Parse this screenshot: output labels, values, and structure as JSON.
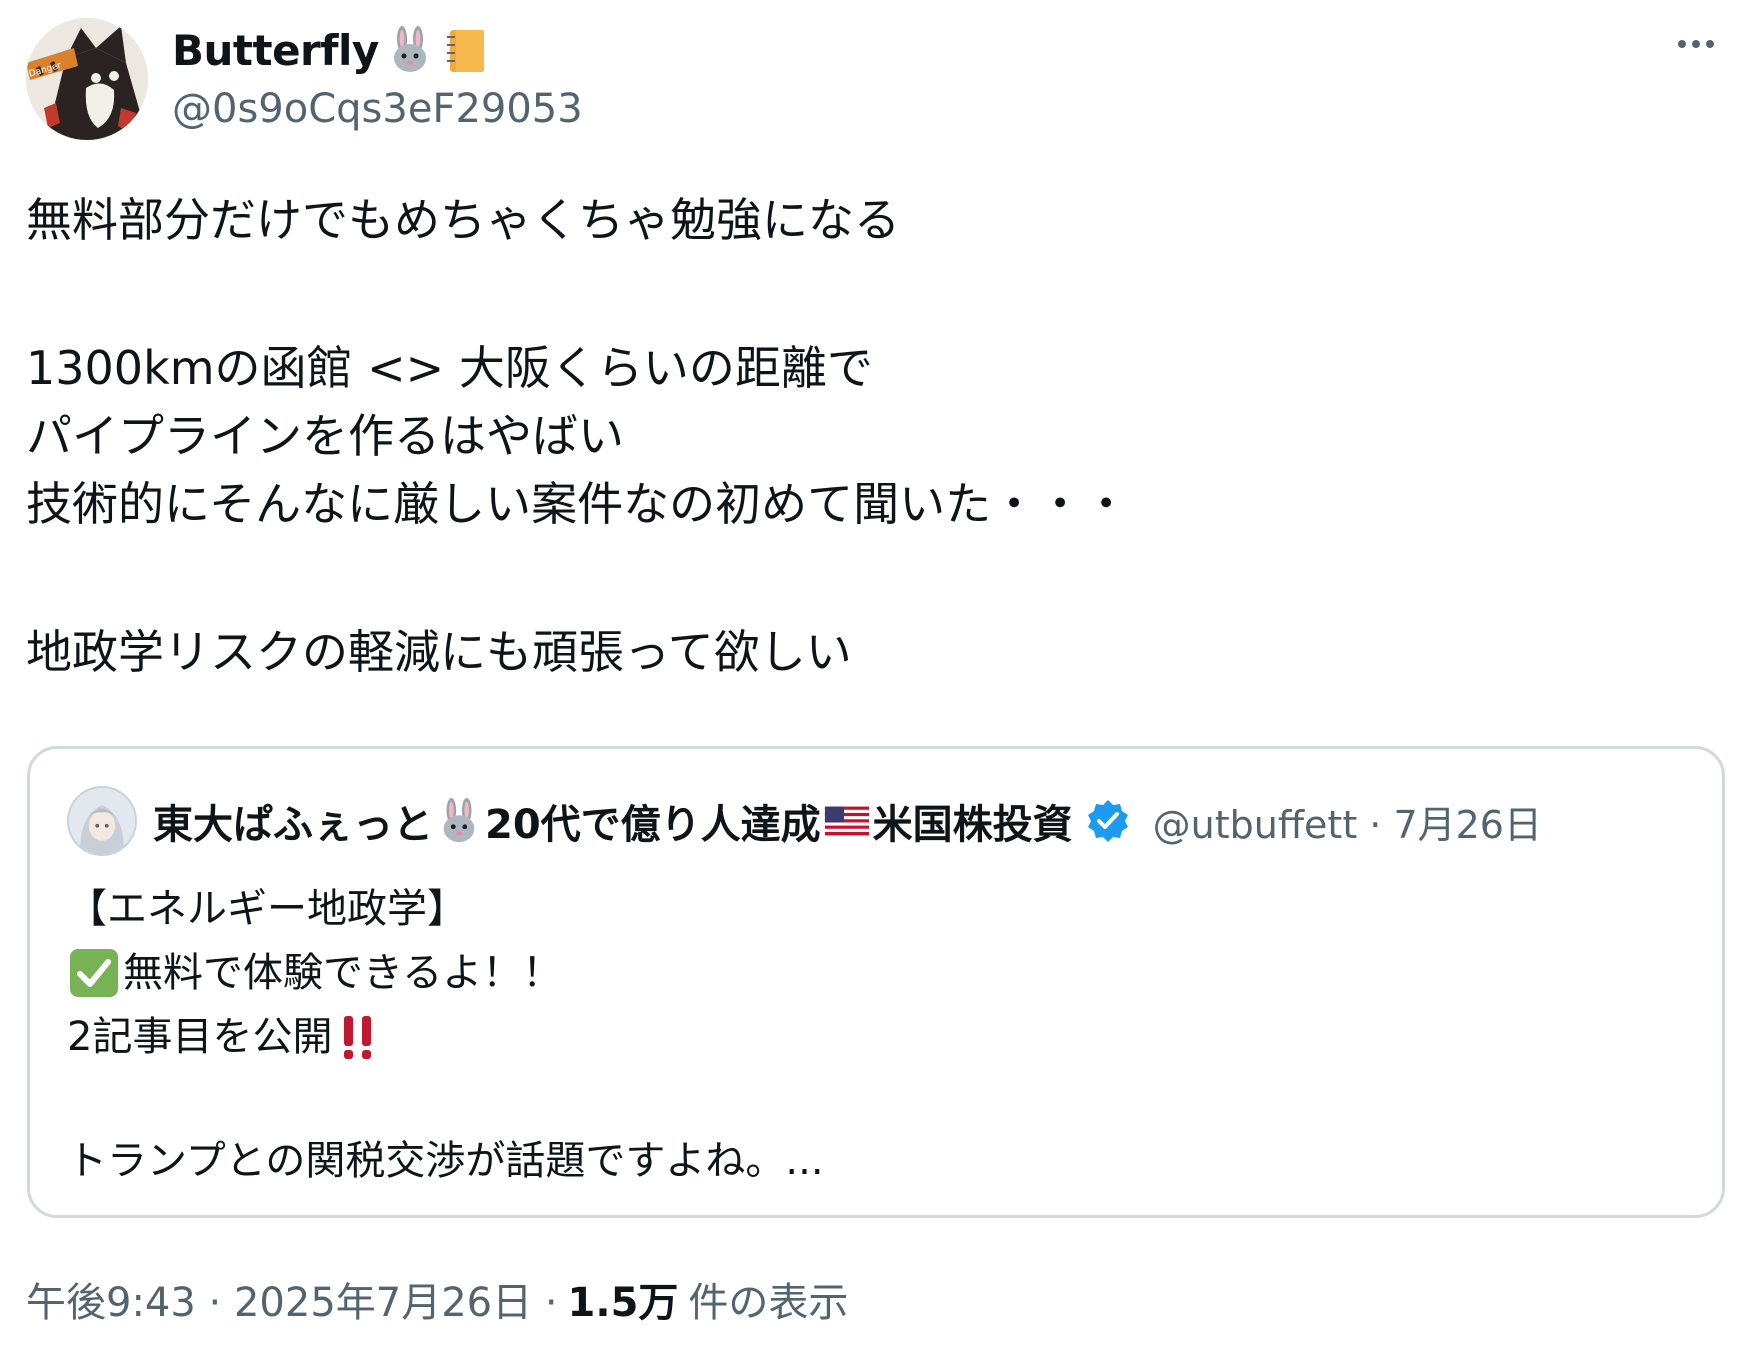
{
  "author": {
    "display_name": "Butterfly",
    "name_emojis": [
      "rabbit-face",
      "notebook"
    ],
    "handle": "@0s9oCqs3eF29053",
    "avatar_text": "Danger"
  },
  "tweet": {
    "paragraphs": [
      [
        "無料部分だけでもめちゃくちゃ勉強になる"
      ],
      [
        "1300kmの函館 <> 大阪くらいの距離で",
        "パイプラインを作るはやばい",
        "技術的にそんなに厳しい案件なの初めて聞いた・・・"
      ],
      [
        "地政学リスクの軽減にも頑張って欲しい"
      ]
    ]
  },
  "quote": {
    "name_part1": "東大ぱふぇっと",
    "name_part2": "20代で億り人達成",
    "name_part3": "米国株投資",
    "name_emojis": [
      "rabbit-face",
      "us-flag"
    ],
    "verified": true,
    "handle_date": "@utbuffett · 7月26日",
    "text": {
      "line1": "【エネルギー地政学】",
      "line2": "無料で体験できるよ！！",
      "line3": "2記事目を公開",
      "line4": "トランプとの関税交渉が話題ですよね。..."
    }
  },
  "footer": {
    "time_date": "午後9:43 · 2025年7月26日 ·",
    "views_count": "1.5万",
    "views_label": "件の表示"
  },
  "colors": {
    "text": "#0f1419",
    "secondary": "#536471",
    "border": "#cfd9de",
    "verified": "#1d9bf0"
  }
}
